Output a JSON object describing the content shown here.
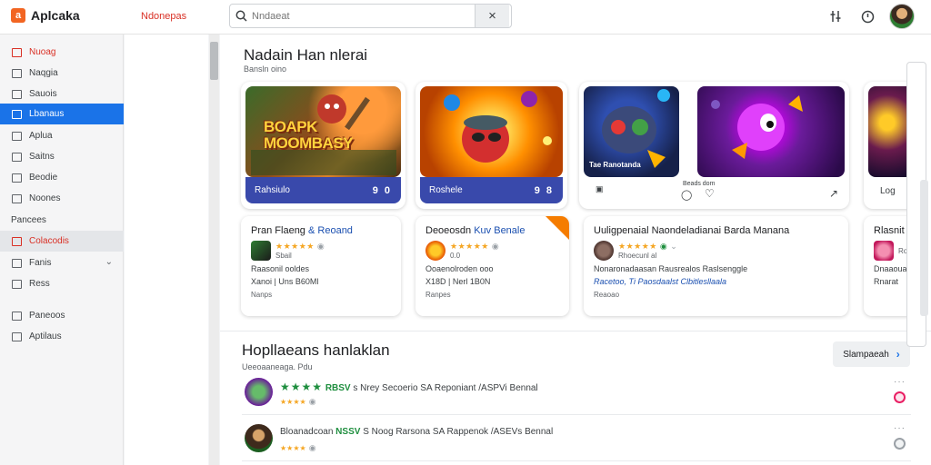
{
  "app": {
    "name": "Aplcaka",
    "logo_letter": "a",
    "section": "Ndonepas"
  },
  "search": {
    "placeholder": "Nndaeat"
  },
  "sidebar": {
    "items": [
      {
        "label": "Nuoag",
        "style": "red"
      },
      {
        "label": "Naqgia",
        "style": "normal"
      },
      {
        "label": "Sauois",
        "style": "normal"
      },
      {
        "label": "Lbanaus",
        "style": "active"
      },
      {
        "label": "Aplua",
        "style": "normal"
      },
      {
        "label": "Saitns",
        "style": "normal"
      },
      {
        "label": "Beodie",
        "style": "normal"
      },
      {
        "label": "Noones",
        "style": "normal"
      },
      {
        "label": "Pancees",
        "style": "heading"
      },
      {
        "label": "Colacodis",
        "style": "red-hl"
      },
      {
        "label": "Fanis",
        "style": "chevron"
      },
      {
        "label": "Ress",
        "style": "normal"
      },
      {
        "label": "Paneoos",
        "style": "normal"
      },
      {
        "label": "Aptilaus",
        "style": "normal"
      }
    ]
  },
  "featured": {
    "title": "Nadain Han nlerai",
    "subtitle": "Bansln oino",
    "cards": [
      {
        "art_text": "BOAPK MOOMBASY",
        "bar_label": "Rahsiulo",
        "bar_nums": "9 0"
      },
      {
        "art_text": "",
        "bar_label": "Roshele",
        "bar_nums": "9 8"
      },
      {
        "art_text": "Tae Ranotanda",
        "action_label": "Beads dom",
        "action_right": ""
      },
      {
        "art_text": "",
        "action_label": "",
        "action_right": "Log"
      }
    ]
  },
  "info_cards": [
    {
      "title": "Pran Flaeng",
      "title_blue": "& Reoand",
      "meta": "Sbail",
      "line1": "Raasonil ooldes",
      "line2": "Xanoi | Uns B60Ml",
      "foot": "Nanps"
    },
    {
      "title": "Deoeosdn",
      "title_blue": "Kuv Benale",
      "meta": "0.0",
      "line1": "Ooaenolroden ooo",
      "line2": "X18D | Nerl 1B0N",
      "foot": "Ranpes"
    },
    {
      "title": "Uuligpenaial Naondeladianai Barda Manana",
      "title_blue": "",
      "meta": "Rhoecunl al",
      "line1": "Nonaronadaasan Rausrealos Raslsenggle",
      "line2": "Racetoo, Ti Paosdaalst Clbitlesllaala",
      "foot": "Reaoao"
    },
    {
      "title": "Rlasnit",
      "title_blue": "",
      "meta": "Ropeasa",
      "line1": "Dnaaouadai",
      "line2": "Rnarat",
      "foot": ""
    }
  ],
  "recommended": {
    "title": "Hopllaeans hanlaklan",
    "subtitle": "Ueeoaaneaga. Pdu",
    "see_more": "Slampaeah",
    "rows": [
      {
        "name": "",
        "score": "RBSV",
        "detail": "s Nrey Secoerio SA Reponiant /ASPVi Bennal"
      },
      {
        "name": "Bloanadcoan",
        "score": "NSSV",
        "detail": "S Noog Rarsona SA Rappenok /ASEVs Bennal"
      }
    ]
  },
  "colors": {
    "accent": "#1a73e8",
    "brand": "#f26522",
    "card_bar": "#3949ab",
    "star": "#f5a623",
    "green": "#1e8e3e"
  },
  "icons": [
    "search-icon",
    "close-icon",
    "filter-icon",
    "clock-icon",
    "chevron-down-icon",
    "chevron-right-icon",
    "heart-icon",
    "share-icon",
    "bookmark-icon",
    "more-icon"
  ]
}
